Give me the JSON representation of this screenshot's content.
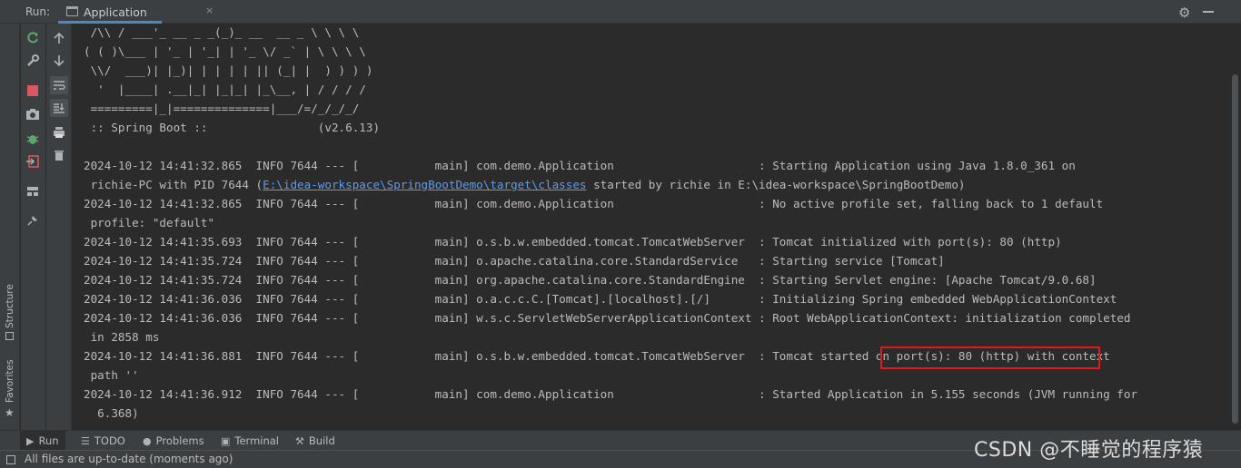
{
  "header": {
    "run_label": "Run:",
    "tab_title": "Application",
    "tab_close": "×"
  },
  "side": {
    "structure_label": "Structure",
    "favorites_label": "Favorites"
  },
  "icons": {
    "rerun": "rerun-icon",
    "settings": "wrench-icon",
    "stop": "stop-icon",
    "screenshot": "camera-icon",
    "debug": "bug-icon",
    "exit": "exit-icon",
    "layout": "layout-icon",
    "pin": "pin-icon",
    "up": "arrow-up-icon",
    "down": "arrow-down-icon",
    "soft_wrap": "soft-wrap-icon",
    "scroll_end": "scroll-to-end-icon",
    "print": "print-icon",
    "trash": "trash-icon",
    "gear": "gear-icon",
    "minimize": "minimize-icon"
  },
  "console": {
    "lines": [
      " /\\\\ / ___'_ __ _ _(_)_ __  __ _ \\ \\ \\ \\",
      "( ( )\\___ | '_ | '_| | '_ \\/ _` | \\ \\ \\ \\",
      " \\\\/  ___)| |_)| | | | | || (_| |  ) ) ) )",
      "  '  |____| .__|_| |_|_| |_\\__, | / / / /",
      " =========|_|==============|___/=/_/_/_/",
      " :: Spring Boot ::                (v2.6.13)",
      "",
      "2024-10-12 14:41:32.865  INFO 7644 --- [           main] com.demo.Application                     : Starting Application using Java 1.8.0_361 on",
      " richie-PC with PID 7644 (",
      "2024-10-12 14:41:32.865  INFO 7644 --- [           main] com.demo.Application                     : No active profile set, falling back to 1 default",
      " profile: \"default\"",
      "2024-10-12 14:41:35.693  INFO 7644 --- [           main] o.s.b.w.embedded.tomcat.TomcatWebServer  : Tomcat initialized with port(s): 80 (http)",
      "2024-10-12 14:41:35.724  INFO 7644 --- [           main] o.apache.catalina.core.StandardService   : Starting service [Tomcat]",
      "2024-10-12 14:41:35.724  INFO 7644 --- [           main] org.apache.catalina.core.StandardEngine  : Starting Servlet engine: [Apache Tomcat/9.0.68]",
      "2024-10-12 14:41:36.036  INFO 7644 --- [           main] o.a.c.c.C.[Tomcat].[localhost].[/]       : Initializing Spring embedded WebApplicationContext",
      "2024-10-12 14:41:36.036  INFO 7644 --- [           main] w.s.c.ServletWebServerApplicationContext : Root WebApplicationContext: initialization completed",
      " in 2858 ms",
      "2024-10-12 14:41:36.881  INFO 7644 --- [           main] o.s.b.w.embedded.tomcat.TomcatWebServer  : Tomcat started on port(s): 80 (http) with context",
      " path ''",
      "2024-10-12 14:41:36.912  INFO 7644 --- [           main] com.demo.Application                     : Started Application in 5.155 seconds (JVM running for",
      "  6.368)"
    ],
    "link_text": "E:\\idea-workspace\\SpringBootDemo\\target\\classes",
    "link_suffix": " started by richie in E:\\idea-workspace\\SpringBootDemo)"
  },
  "bottom_tabs": {
    "run": "Run",
    "todo": "TODO",
    "problems": "Problems",
    "terminal": "Terminal",
    "build": "Build"
  },
  "status": {
    "text": "All files are up-to-date (moments ago)"
  },
  "watermark": "CSDN @不睡觉的程序猿",
  "colors": {
    "background": "#2b2b2b",
    "panel": "#3c3f41",
    "text": "#bbbbbb",
    "link": "#589df6",
    "highlight_box": "#e0191c",
    "rerun_green": "#59a869",
    "stop_red": "#db5860"
  }
}
